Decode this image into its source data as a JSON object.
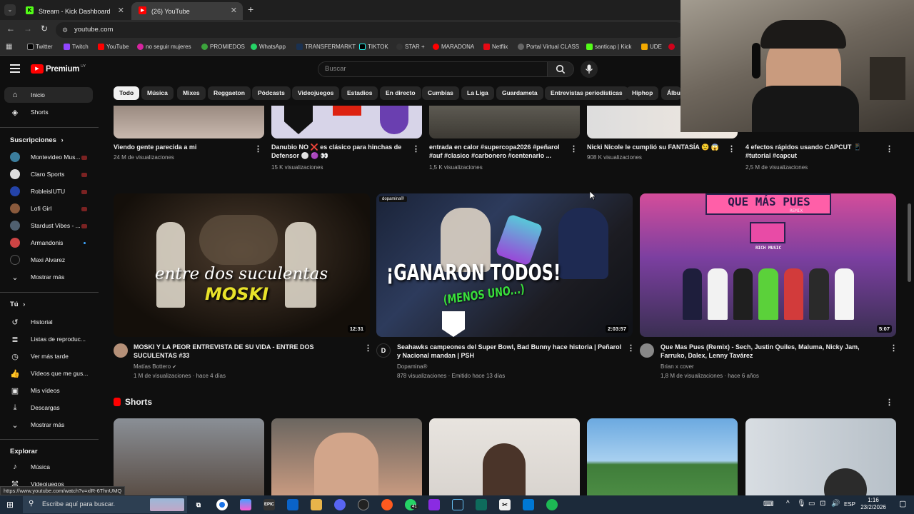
{
  "browser": {
    "tabs": [
      {
        "label": "Stream - Kick Dashboard",
        "favicon": "kick-icon"
      },
      {
        "label": "(26) YouTube",
        "favicon": "youtube-icon"
      }
    ],
    "url": "youtube.com",
    "bookmarks": [
      "Twitter",
      "Twitch",
      "YouTube",
      "no seguir mujeres",
      "PROMIEDOS",
      "WhatsApp",
      "TRANSFERMARKT",
      "TIKTOK",
      "STAR +",
      "MARADONA",
      "Netflix",
      "Portal Virtual CLASS",
      "santicap | Kick",
      "UDE"
    ],
    "status_url": "https://www.youtube.com/watch?v=xlR-6ThnUMQ"
  },
  "youtube": {
    "logo_label": "Premium",
    "logo_sup": "UY",
    "search_placeholder": "Buscar",
    "chips": [
      "Todo",
      "Música",
      "Mixes",
      "Reggaeton",
      "Pódcasts",
      "Videojuegos",
      "Estadios",
      "En directo",
      "Cumbias",
      "La Liga",
      "Guardameta",
      "Entrevistas periodísticas",
      "Hiphop",
      "Álbum"
    ]
  },
  "sidebar": {
    "main": [
      {
        "label": "Inicio",
        "icon": "home-icon"
      },
      {
        "label": "Shorts",
        "icon": "shorts-icon"
      }
    ],
    "subs_title": "Suscripciones",
    "subs": [
      "Montevideo Mus...",
      "Claro Sports",
      "RobleisIUTU",
      "Lofi Girl",
      "Stardust Vibes - ...",
      "Armandonis",
      "Maxi Alvarez"
    ],
    "more_label": "Mostrar más",
    "you_title": "Tú",
    "you": [
      {
        "label": "Historial",
        "icon": "history-icon"
      },
      {
        "label": "Listas de reproduc...",
        "icon": "playlist-icon"
      },
      {
        "label": "Ver más tarde",
        "icon": "clock-icon"
      },
      {
        "label": "Vídeos que me gus...",
        "icon": "thumbs-up-icon"
      },
      {
        "label": "Mis vídeos",
        "icon": "video-icon"
      },
      {
        "label": "Descargas",
        "icon": "download-icon"
      },
      {
        "label": "Mostrar más",
        "icon": "chevron-down-icon"
      }
    ],
    "explore_title": "Explorar",
    "explore": [
      {
        "label": "Música",
        "icon": "music-icon"
      },
      {
        "label": "Videojuegos",
        "icon": "gamepad-icon"
      }
    ]
  },
  "row1": [
    {
      "title": "Viendo gente parecida a mi",
      "meta": "24 M de visualizaciones"
    },
    {
      "title": "Danubio NO ❌ es clásico para hinchas de Defensor ⚪ 🟣 👀",
      "meta": "15 K visualizaciones"
    },
    {
      "title": "entrada en calor #supercopa2026 #peñarol #auf #clasico #carbonero #centenario ...",
      "meta": "1,5 K visualizaciones"
    },
    {
      "title": "Nicki Nicole le cumplió su FANTASÍA 😉 😱",
      "meta": "908 K visualizaciones"
    },
    {
      "title": "4 efectos rápidos usando CAPCUT 📱 #tutorial #capcut",
      "meta": "2,5 M de visualizaciones"
    }
  ],
  "row2": [
    {
      "title": "MOSKI Y LA PEOR ENTREVISTA DE SU VIDA - ENTRE DOS SUCULENTAS #33",
      "channel": "Matías Bottero",
      "meta": "1 M de visualizaciones · hace 4 días",
      "duration": "12:31",
      "thumb_text_1": "entre dos suculentas",
      "thumb_text_2": "MOSKI"
    },
    {
      "title": "Seahawks campeones del Super Bowl, Bad Bunny hace historia | Peñarol y Nacional mandan | PSH",
      "channel": "Dopamina®",
      "meta": "878 visualizaciones · Emitido hace 13 días",
      "duration": "2:03:57",
      "thumb_text_1": "¡GANARON TODOS!",
      "thumb_text_2": "(MENOS UNO...)",
      "thumb_badge": "dopamina®"
    },
    {
      "title": "Que Mas Pues (Remix) - Sech, Justin Quiles, Maluma, Nicky Jam, Farruko, Dalex, Lenny Tavárez",
      "channel": "Brian x cover",
      "meta": "1,8 M de visualizaciones · hace 6 años",
      "duration": "5:07",
      "thumb_text_1": "QUE MÁS PUES",
      "thumb_text_2": "REMIX",
      "thumb_text_3": "RICH MUSIC"
    }
  ],
  "shorts_title": "Shorts",
  "taskbar": {
    "search_placeholder": "Escribe aquí para buscar.",
    "lang": "ESP",
    "time": "1:16",
    "date": "23/2/2026",
    "whatsapp_badge": "41"
  },
  "colors": {
    "youtube_red": "#ff0000",
    "kick_green": "#53fc18",
    "bg": "#0f0f0f"
  }
}
